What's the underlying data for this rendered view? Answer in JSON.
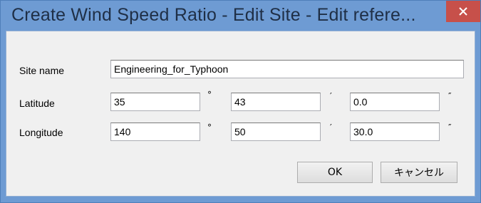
{
  "window": {
    "title": "Create Wind Speed Ratio - Edit Site - Edit refere...",
    "close_glyph": "×",
    "colors": {
      "frame": "#6e9bd3",
      "close": "#c7504a",
      "client": "#f0f0f0"
    }
  },
  "form": {
    "site_name_label": "Site name",
    "site_name_value": "Engineering_for_Typhoon",
    "latitude_label": "Latitude",
    "latitude": {
      "degrees": "35",
      "minutes": "43",
      "seconds": "0.0"
    },
    "longitude_label": "Longitude",
    "longitude": {
      "degrees": "140",
      "minutes": "50",
      "seconds": "30.0"
    },
    "units": {
      "degree": "°",
      "minute": "′",
      "second": "″"
    }
  },
  "buttons": {
    "ok_label": "OK",
    "cancel_label": "キャンセル"
  },
  "icons": {
    "close": "close-icon"
  }
}
